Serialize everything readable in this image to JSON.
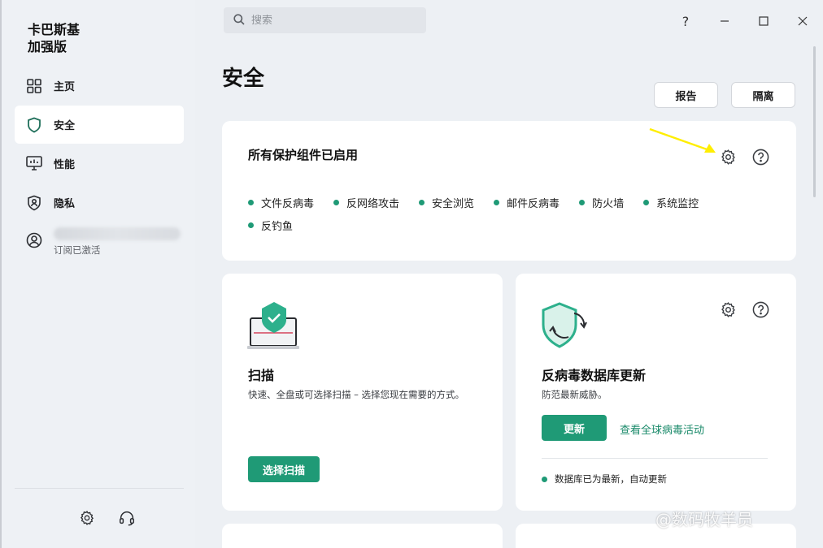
{
  "app": {
    "title": "卡巴斯基\n加强版"
  },
  "search": {
    "placeholder": "搜索"
  },
  "window_controls": {
    "help": "?",
    "minimize": "—",
    "maximize": "☐",
    "close": "✕"
  },
  "sidebar": {
    "items": [
      {
        "label": "主页",
        "icon": "home-grid-icon"
      },
      {
        "label": "安全",
        "icon": "shield-icon",
        "active": true
      },
      {
        "label": "性能",
        "icon": "monitor-icon"
      },
      {
        "label": "隐私",
        "icon": "privacy-shield-icon"
      }
    ],
    "account": {
      "status": "订阅已激活"
    },
    "bottom": {
      "settings_icon": "gear-icon",
      "support_icon": "headset-icon"
    }
  },
  "page": {
    "title": "安全",
    "buttons": {
      "report": "报告",
      "quarantine": "隔离"
    }
  },
  "protection": {
    "title": "所有保护组件已启用",
    "components": [
      "文件反病毒",
      "反网络攻击",
      "安全浏览",
      "邮件反病毒",
      "防火墙",
      "系统监控",
      "反钓鱼"
    ]
  },
  "scan_card": {
    "title": "扫描",
    "description": "快速、全盘或可选择扫描 – 选择您现在需要的方式。",
    "button": "选择扫描"
  },
  "update_card": {
    "title": "反病毒数据库更新",
    "description": "防范最新威胁。",
    "button": "更新",
    "link": "查看全球病毒活动",
    "status": "数据库已为最新，自动更新"
  },
  "watermark": {
    "text": "@数码牧羊员"
  },
  "colors": {
    "accent": "#1f9a76",
    "annotation_arrow": "#ffee00"
  }
}
